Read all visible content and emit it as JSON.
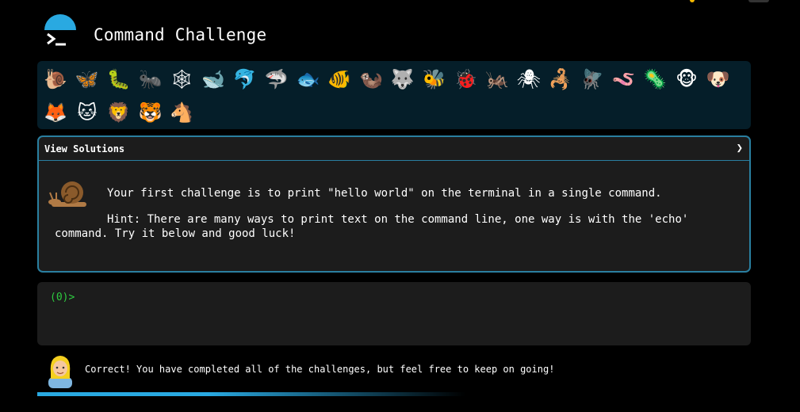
{
  "app": {
    "title": "Command Challenge",
    "accent": "#29a9e1"
  },
  "animals": [
    {
      "name": "snail",
      "glyph": "🐌"
    },
    {
      "name": "butterfly",
      "glyph": "🦋"
    },
    {
      "name": "bug",
      "glyph": "🐛"
    },
    {
      "name": "ant",
      "glyph": "🐜"
    },
    {
      "name": "spider-web",
      "glyph": "🕸"
    },
    {
      "name": "whale",
      "glyph": "🐋"
    },
    {
      "name": "dolphin",
      "glyph": "🐬"
    },
    {
      "name": "shark",
      "glyph": "🦈"
    },
    {
      "name": "fish",
      "glyph": "🐟"
    },
    {
      "name": "tropical-fish",
      "glyph": "🐠"
    },
    {
      "name": "otter",
      "glyph": "🦦"
    },
    {
      "name": "wolf",
      "glyph": "🐺"
    },
    {
      "name": "bee",
      "glyph": "🐝"
    },
    {
      "name": "lady-beetle",
      "glyph": "🐞"
    },
    {
      "name": "cricket",
      "glyph": "🦗"
    },
    {
      "name": "spider",
      "glyph": "🕷"
    },
    {
      "name": "scorpion",
      "glyph": "🦂"
    },
    {
      "name": "fly",
      "glyph": "🪰"
    },
    {
      "name": "worm",
      "glyph": "🪱"
    },
    {
      "name": "microbe",
      "glyph": "🦠"
    },
    {
      "name": "monkey",
      "glyph": "🐵"
    },
    {
      "name": "dog",
      "glyph": "🐶"
    },
    {
      "name": "fox",
      "glyph": "🦊"
    },
    {
      "name": "cat",
      "glyph": "🐱"
    },
    {
      "name": "lion",
      "glyph": "🦁"
    },
    {
      "name": "tiger",
      "glyph": "🐯"
    },
    {
      "name": "horse",
      "glyph": "🐴"
    }
  ],
  "challenge": {
    "view_solutions": "View Solutions",
    "chevron": "❯",
    "text": "Your first challenge is to print \"hello world\" on the terminal in a single command.",
    "hint": "Hint: There are many ways to print text on the command line, one way is with the 'echo' command. Try it below and good luck!"
  },
  "terminal": {
    "prompt": "(0)>"
  },
  "feedback": {
    "message": "Correct! You have completed all of the challenges, but feel free to keep on going!"
  },
  "progress": {
    "fraction": 1.0
  }
}
